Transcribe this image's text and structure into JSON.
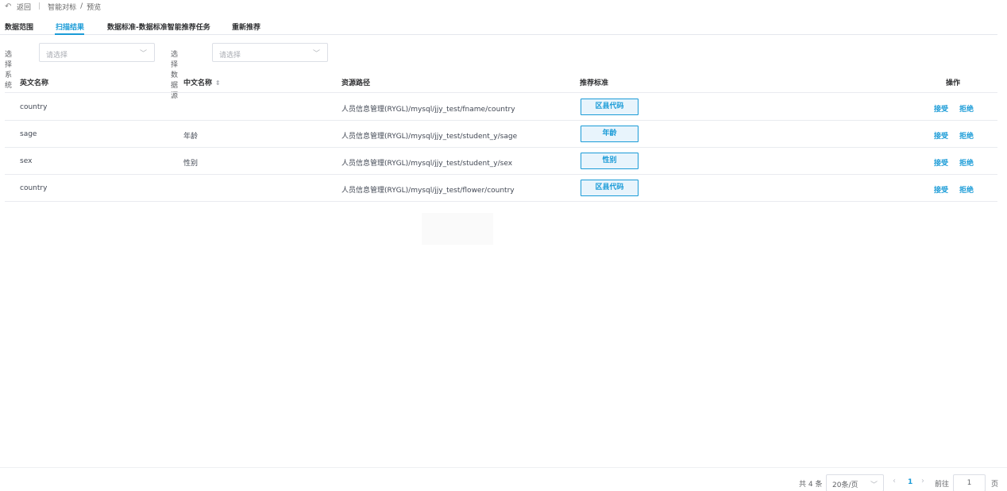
{
  "header": {
    "back_label": "返回",
    "breadcrumb": [
      "智能对标",
      "预览"
    ]
  },
  "tabs": [
    {
      "label": "数据范围",
      "active": false
    },
    {
      "label": "扫描结果",
      "active": true
    },
    {
      "label": "数据标准-数据标准智能推荐任务",
      "active": false
    },
    {
      "label": "重新推荐",
      "active": false
    }
  ],
  "filters": {
    "system_label": "选择系统",
    "system_placeholder": "请选择",
    "datasource_label": "选择数据源",
    "datasource_placeholder": "请选择"
  },
  "table": {
    "columns": [
      "英文名称",
      "中文名称",
      "资源路径",
      "推荐标准",
      "操作"
    ],
    "rows": [
      {
        "en": "country",
        "cn": "",
        "path": "人员信息管理(RYGL)/mysql/jjy_test/fname/country",
        "standard": "区县代码",
        "accept": "接受",
        "reject": "拒绝"
      },
      {
        "en": "sage",
        "cn": "年龄",
        "path": "人员信息管理(RYGL)/mysql/jjy_test/student_y/sage",
        "standard": "年龄",
        "accept": "接受",
        "reject": "拒绝"
      },
      {
        "en": "sex",
        "cn": "性别",
        "path": "人员信息管理(RYGL)/mysql/jjy_test/student_y/sex",
        "standard": "性别",
        "accept": "接受",
        "reject": "拒绝"
      },
      {
        "en": "country",
        "cn": "",
        "path": "人员信息管理(RYGL)/mysql/jjy_test/flower/country",
        "standard": "区县代码",
        "accept": "接受",
        "reject": "拒绝"
      }
    ]
  },
  "pagination": {
    "total_text": "共 4 条",
    "page_size": "20条/页",
    "current_page": "1",
    "goto_label": "前往",
    "goto_value": "1",
    "goto_suffix": "页"
  },
  "colors": {
    "accent": "#1a9bd7",
    "border": "#dcdfe6",
    "tag_bg": "#e8f4fc"
  }
}
